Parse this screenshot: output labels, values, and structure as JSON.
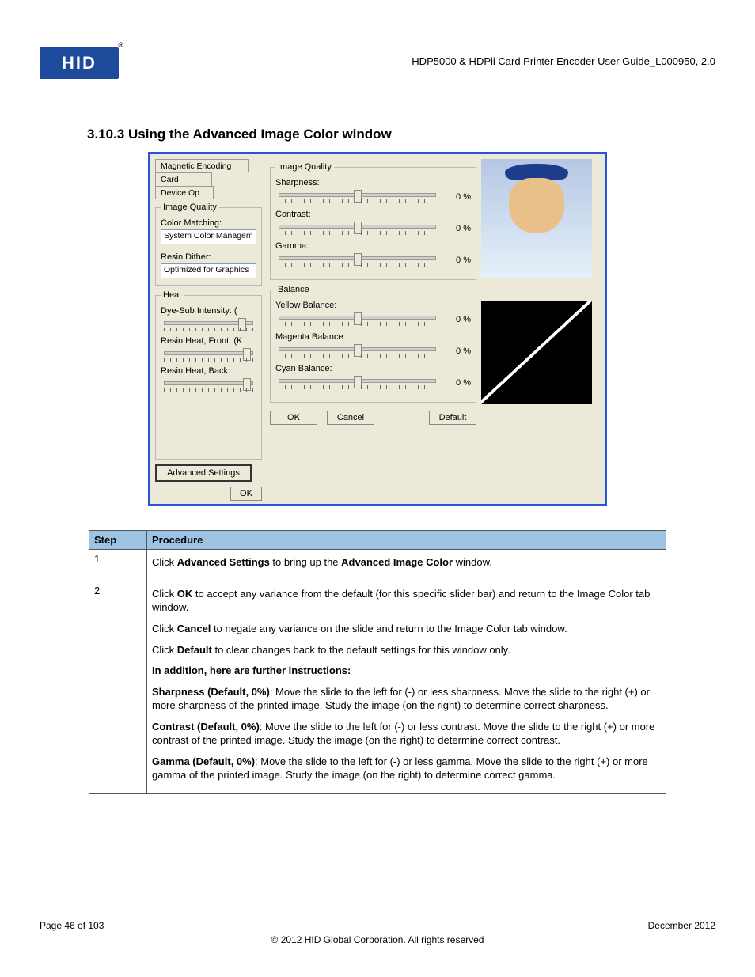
{
  "header": {
    "logo_text": "HID",
    "doc_title": "HDP5000 & HDPii Card Printer Encoder User Guide_L000950, 2.0"
  },
  "section_heading": "3.10.3  Using the Advanced Image Color window",
  "screenshot": {
    "tabs": {
      "magnetic": "Magnetic Encoding",
      "card": "Card",
      "device": "Device Op"
    },
    "iq_group": "Image Quality",
    "color_matching_label": "Color Matching:",
    "color_matching_value": "System Color Managem",
    "resin_dither_label": "Resin Dither:",
    "resin_dither_value": "Optimized for Graphics",
    "heat_group": "Heat",
    "dye_sub_label": "Dye-Sub Intensity: (",
    "resin_front_label": "Resin Heat, Front: (K",
    "resin_back_label": "Resin Heat, Back:",
    "advanced_btn": "Advanced Settings",
    "ok_btn": "OK",
    "right_iq_group": "Image Quality",
    "sharpness_label": "Sharpness:",
    "contrast_label": "Contrast:",
    "gamma_label": "Gamma:",
    "balance_group": "Balance",
    "yellow_label": "Yellow Balance:",
    "magenta_label": "Magenta Balance:",
    "cyan_label": "Cyan Balance:",
    "zero_pct": "0 %",
    "cancel_btn": "Cancel",
    "default_btn": "Default"
  },
  "table": {
    "h_step": "Step",
    "h_proc": "Procedure",
    "rows": {
      "r1_step": "1",
      "r1_l1a": "Click ",
      "r1_l1b": "Advanced Settings",
      "r1_l1c": " to bring up the ",
      "r1_l1d": "Advanced Image Color",
      "r1_l1e": " window.",
      "r2_step": "2",
      "r2_l1a": "Click ",
      "r2_l1b": "OK",
      "r2_l1c": " to accept any variance from the default (for this specific slider bar) and return to the Image Color tab window.",
      "r2_l2a": "Click ",
      "r2_l2b": "Cancel",
      "r2_l2c": " to negate any variance on the slide and return to the Image Color tab window.",
      "r2_l3a": "Click ",
      "r2_l3b": "Default",
      "r2_l3c": " to clear changes back to the default settings for this window only.",
      "r2_l4": "In addition, here are further instructions:",
      "r2_l5a": "Sharpness (Default, 0%)",
      "r2_l5b": ":  Move the slide to the left for (-) or less sharpness. Move the slide to the right (+) or more sharpness of the printed image. Study the image (on the right) to determine correct sharpness.",
      "r2_l6a": "Contrast (Default, 0%)",
      "r2_l6b": ":  Move the slide to the left for (-) or less contrast. Move the slide to the right (+) or more contrast of the printed image. Study the image (on the right) to determine correct contrast.",
      "r2_l7a": "Gamma (Default, 0%)",
      "r2_l7b": ":  Move the slide to the left for (-) or less gamma. Move the slide to the right (+) or more gamma of the printed image. Study the image (on the right) to determine correct gamma."
    }
  },
  "footer": {
    "page": "Page 46 of 103",
    "date": "December 2012",
    "copyright": "© 2012 HID Global Corporation. All rights reserved"
  }
}
